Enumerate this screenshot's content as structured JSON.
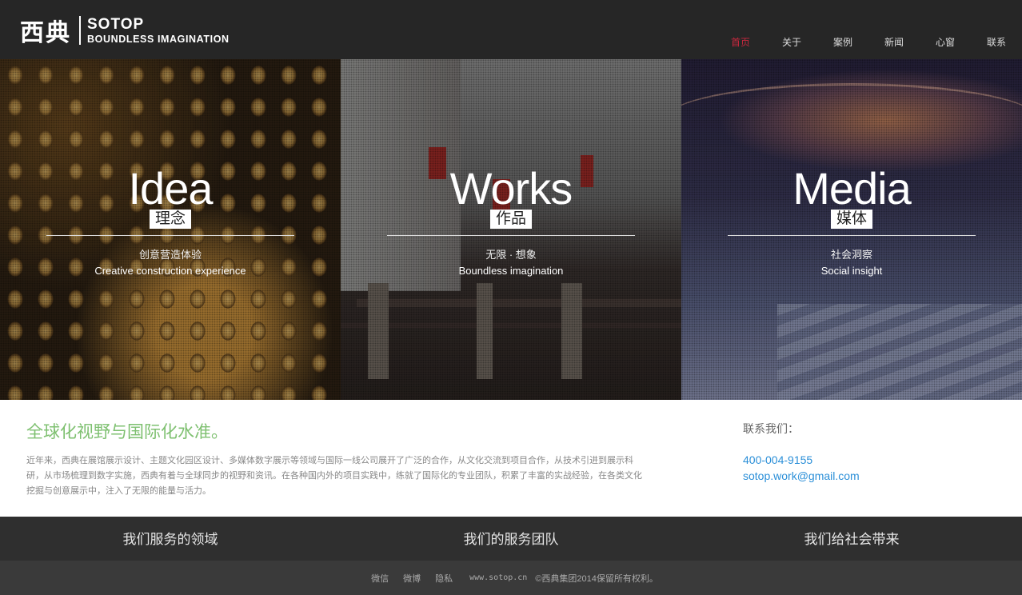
{
  "header": {
    "logo_cn": "西典",
    "logo_en_1": "SOTOP",
    "logo_en_2": "BOUNDLESS IMAGINATION",
    "nav": [
      "首页",
      "关于",
      "案例",
      "新闻",
      "心窗",
      "联系"
    ],
    "nav_active_index": 0
  },
  "colors": {
    "nav_active": "#c9283e",
    "accent_green": "#7ec070",
    "link_blue": "#2b8fd8",
    "header_bg": "#262626"
  },
  "panels": [
    {
      "title": "Idea",
      "badge": "理念",
      "cn": "创意营造体验",
      "en": "Creative construction experience"
    },
    {
      "title": "Works",
      "badge": "作品",
      "cn": "无限 · 想象",
      "en": "Boundless imagination"
    },
    {
      "title": "Media",
      "badge": "媒体",
      "cn": "社会洞察",
      "en": "Social insight"
    }
  ],
  "info": {
    "title": "全球化视野与国际化水准。",
    "text": "近年来，西典在展馆展示设计、主题文化园区设计、多媒体数字展示等领域与国际一线公司展开了广泛的合作，从文化交流到项目合作，从技术引进到展示科研，从市场梳理到数字实施，西典有着与全球同步的视野和资讯。在各种国内外的项目实践中，练就了国际化的专业团队，积累了丰富的实战经验，在各类文化挖掘与创意展示中，注入了无限的能量与活力。",
    "contact_title": "联系我们：",
    "phone": "400-004-9155",
    "email": "sotop.work@gmail.com"
  },
  "services": [
    "我们服务的领域",
    "我们的服务团队",
    "我们给社会带来"
  ],
  "footer": {
    "links": [
      "微信",
      "微博",
      "隐私"
    ],
    "url": "www.sotop.cn",
    "copyright": "©西典集团2014保留所有权利。"
  }
}
